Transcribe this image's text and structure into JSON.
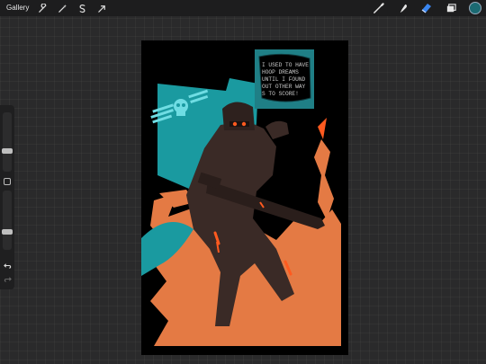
{
  "topbar": {
    "gallery_label": "Gallery",
    "left_tools": [
      "wrench-icon",
      "magic-wand-icon",
      "selection-icon",
      "transform-arrow-icon"
    ],
    "right_tools": [
      "brush-icon",
      "smudge-icon",
      "eraser-icon",
      "layers-icon"
    ],
    "active_tool": "eraser-icon",
    "current_color": "#1b6a72"
  },
  "sidebar": {
    "brush_size_level": 0.34,
    "opacity_level": 0.28
  },
  "artwork": {
    "speech_bubble_lines": [
      "I USED TO HAVE",
      "HOOP DREAMS",
      "UNTIL I FOUND",
      "OUT OTHER WAY",
      "S TO SCORE!"
    ],
    "colors": {
      "background": "#000000",
      "teal": "#1a9aa0",
      "orange": "#e47a44",
      "bubble": "#1f7f86",
      "logo": "#6fdde3",
      "soldier": "#3a2a26",
      "glow": "#ff5a1f"
    }
  }
}
